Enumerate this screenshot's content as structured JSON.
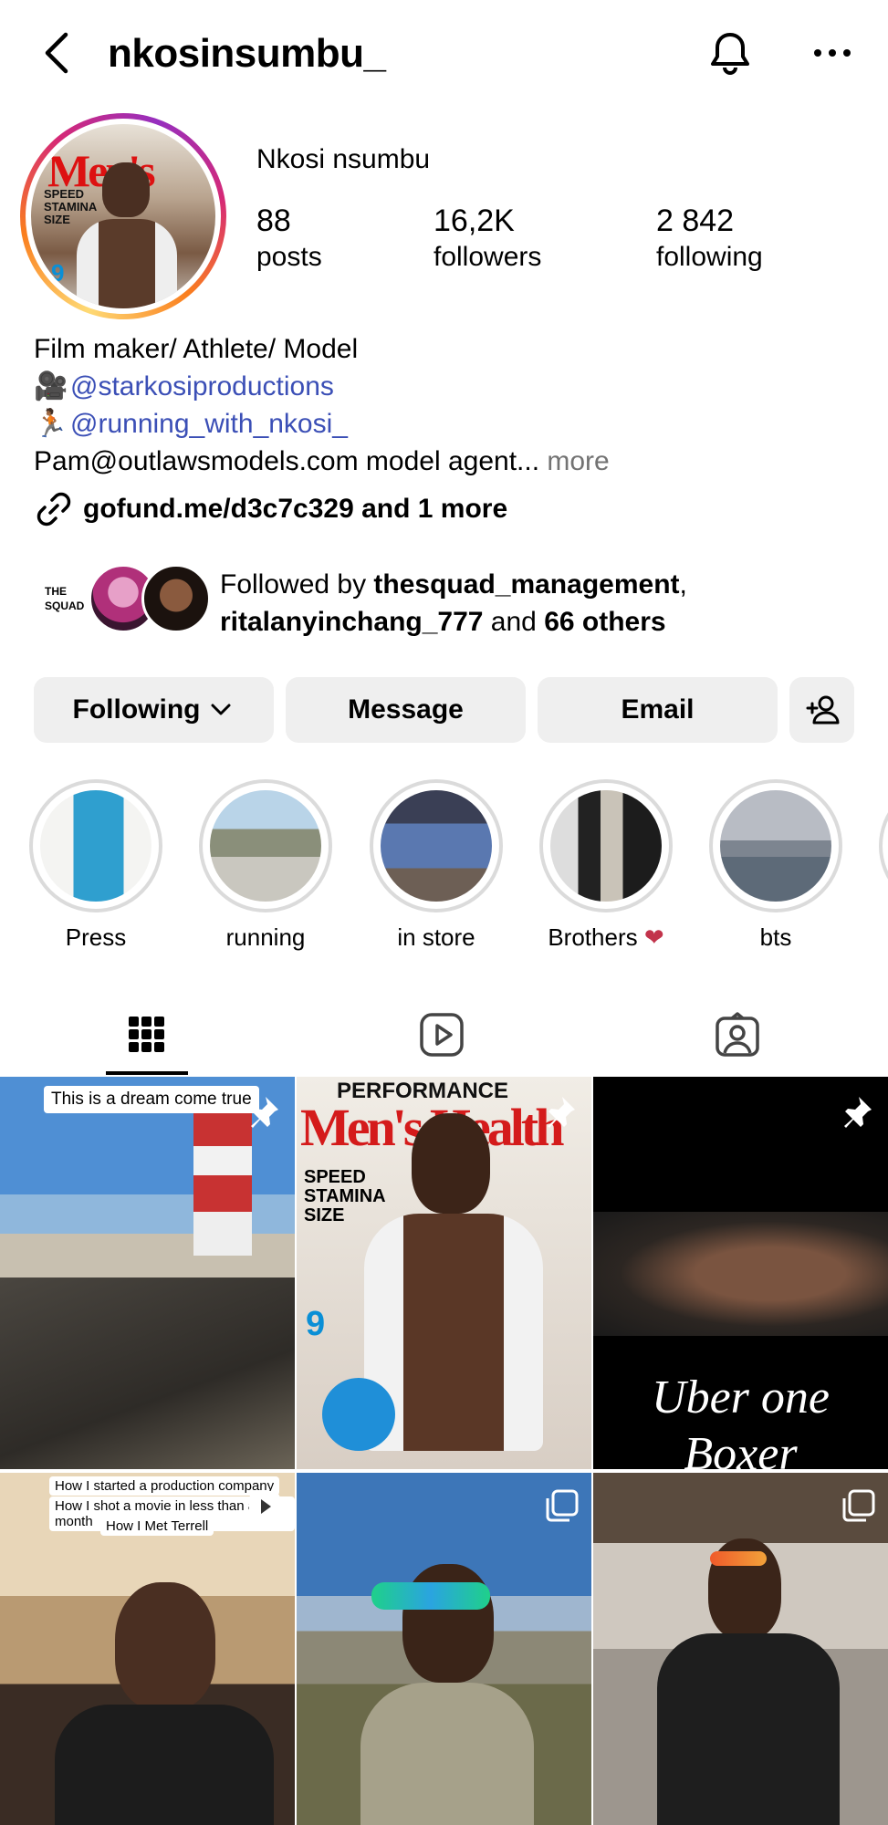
{
  "header": {
    "username": "nkosinsumbu_"
  },
  "profile": {
    "display_name": "Nkosi nsumbu",
    "stats": [
      {
        "value": "88",
        "label": "posts"
      },
      {
        "value": "16,2K",
        "label": "followers"
      },
      {
        "value": "2 842",
        "label": "following"
      }
    ],
    "bio": {
      "line1": "Film maker/ Athlete/ Model",
      "mention1": "@starkosiproductions",
      "mention2": "@running_with_nkosi_",
      "line4": "Pam@outlawsmodels.com model agent...",
      "more": " more"
    },
    "link": "gofund.me/d3c7c329 and 1 more",
    "followed_by": {
      "prefix": "Followed by ",
      "user1": "thesquad_management",
      "sep": ",",
      "user2": "ritalanyinchang_777",
      "and": " and ",
      "others": "66 others"
    }
  },
  "actions": {
    "following": "Following",
    "message": "Message",
    "email": "Email"
  },
  "highlights": [
    {
      "label": "Press"
    },
    {
      "label": "running"
    },
    {
      "label": "in store"
    },
    {
      "label": "Brothers"
    },
    {
      "label": "bts"
    }
  ],
  "grid": {
    "post1_caption": "This is a dream come true",
    "post2_mag_top": "PERFORMANCE",
    "post2_mag_title": "Men's Health",
    "post2_headline": "SPEED STAMINA SIZE",
    "post3_text1": "Uber one",
    "post3_text2": "Boxer",
    "post4_caption1": "How I started a production company",
    "post4_caption2": "How I shot a movie in less than a month",
    "post4_caption3": "How I Met Terrell"
  },
  "colors": {
    "mention": "#3b4fb6",
    "button_bg": "#efefef",
    "muted": "#737373"
  }
}
